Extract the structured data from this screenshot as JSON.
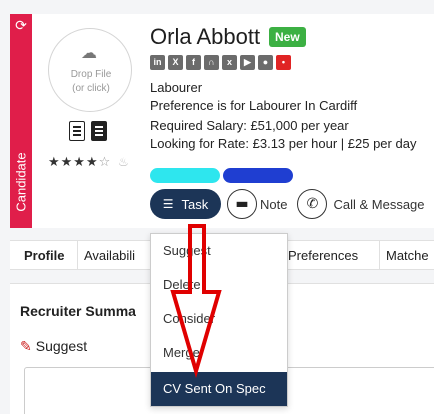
{
  "sidebar_strip": {
    "label": "Candidate",
    "icon": "refresh-icon"
  },
  "photo": {
    "placeholder_line1": "Drop File",
    "placeholder_line2": "(or click)",
    "icon": "cloud-upload-icon"
  },
  "candidate": {
    "name": "Orla Abbott",
    "badge": "New",
    "job_title": "Labourer",
    "preference": "Preference is for Labourer In Cardiff",
    "required_salary": "Required Salary: £51,000 per year",
    "rate": "Looking for Rate: £3.13 per hour | £25 per day",
    "rating": {
      "filled": 4,
      "max": 5
    }
  },
  "social_icons": [
    "linkedin-icon",
    "x-icon",
    "facebook-icon",
    "headphones-icon",
    "xing-icon",
    "youtube-icon",
    "globe-icon",
    "map-pin-icon"
  ],
  "actions": {
    "task_label": "Task",
    "note_label": "Note",
    "call_label": "Call & Message"
  },
  "tabs": [
    "Profile",
    "Availabili",
    "Preferences",
    "Matche"
  ],
  "panel": {
    "section_title": "Recruiter Summa",
    "suggest_label": "Suggest"
  },
  "task_menu": {
    "items": [
      "Suggest",
      "Delete",
      "Consider",
      "Merge",
      "CV Sent On Spec"
    ],
    "highlighted": "CV Sent On Spec"
  },
  "colors": {
    "candidate_strip": "#e01e4a",
    "new_badge": "#3cb043",
    "task_button": "#1c3557",
    "tag_cyan": "#2ee6ee",
    "tag_blue": "#1f3ed1",
    "annotation_arrow": "#e00000"
  }
}
